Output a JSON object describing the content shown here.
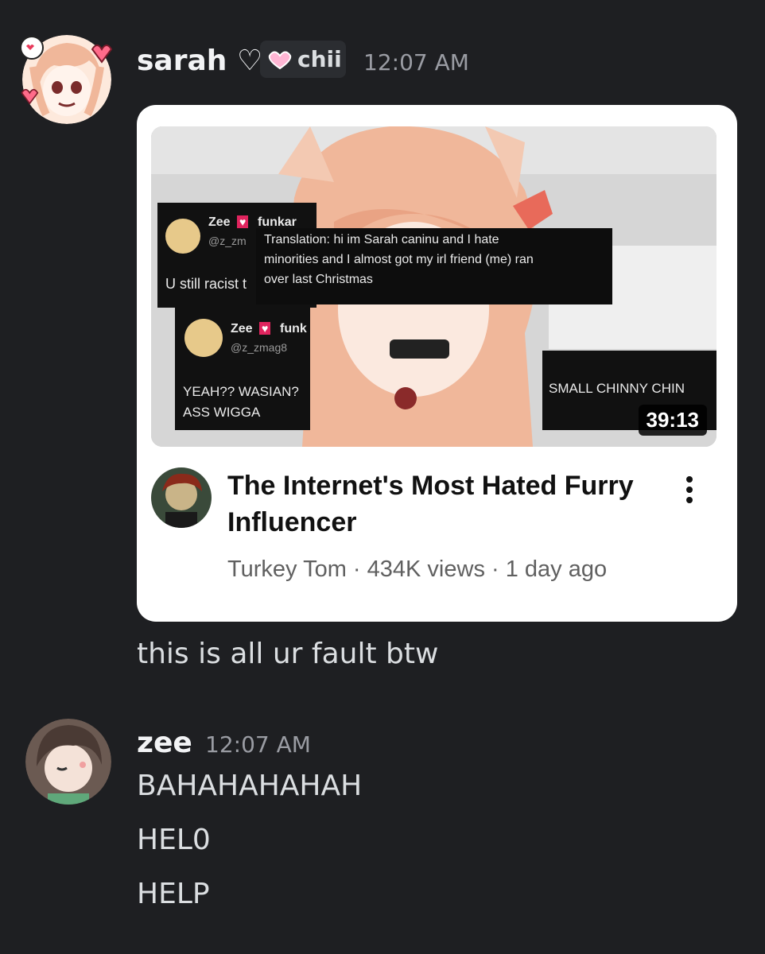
{
  "messages": [
    {
      "author": "sarah",
      "author_heart": "♡",
      "role_tag": "chii",
      "timestamp": "12:07 AM",
      "embed": {
        "thumbnail": {
          "tweet1_name": "Zee",
          "tweet1_name_tail": "funkar",
          "tweet1_handle": "@z_zm",
          "tweet1_body": "U still racist t",
          "caption_lines": [
            "Translation: hi im Sarah caninu and I hate",
            "minorities and I almost got my irl friend (me) ran",
            "over last Christmas"
          ],
          "tweet2_name": "Zee",
          "tweet2_name_tail": "funk",
          "tweet2_handle": "@z_zmag8",
          "tweet2_body_lines": [
            "YEAH?? WASIAN?",
            "ASS WIGGA"
          ],
          "right_text": "SMALL CHINNY CHIN",
          "duration": "39:13"
        },
        "title": "The Internet's Most Hated Furry Influencer",
        "channel": "Turkey Tom",
        "meta": "Turkey Tom · 434K views · 1 day ago",
        "menu_icon": "kebab-menu-icon"
      },
      "text_lines": [
        "this is all ur fault btw"
      ]
    },
    {
      "author": "zee",
      "timestamp": "12:07 AM",
      "text_lines": [
        "BAHAHAHAHAH",
        "HEL0",
        "HELP"
      ]
    }
  ],
  "colors": {
    "background": "#1e1f22",
    "username": "#f2f3f5",
    "timestamp": "#9a9ca3",
    "message_text": "#dbdee1"
  }
}
